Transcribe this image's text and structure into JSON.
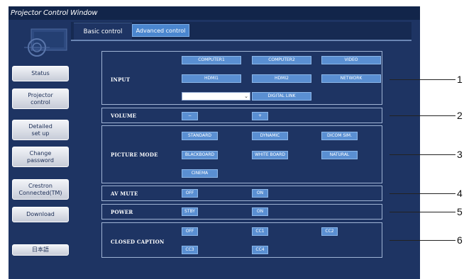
{
  "window": {
    "title": "Projector Control Window"
  },
  "sidebar": {
    "items": [
      {
        "label": "Status"
      },
      {
        "label": "Projector control"
      },
      {
        "label": "Detailed set up"
      },
      {
        "label": "Change password"
      },
      {
        "label": "Crestron Connected(TM)"
      },
      {
        "label": "Download"
      },
      {
        "label": "日本語"
      }
    ]
  },
  "tabs": {
    "basic": "Basic control",
    "advanced": "Advanced control"
  },
  "sections": {
    "input": {
      "label": "INPUT",
      "buttons": [
        "COMPUTER1",
        "COMPUTER2",
        "VIDEO",
        "HDMI1",
        "HDMI2",
        "NETWORK"
      ],
      "digital_link": "DIGITAL LINK",
      "select_value": ""
    },
    "volume": {
      "label": "VOLUME",
      "minus": "−",
      "plus": "+"
    },
    "picture_mode": {
      "label": "PICTURE MODE",
      "buttons": [
        "STANDARD",
        "DYNAMIC",
        "DICOM SIM.",
        "BLACKBOARD",
        "WHITE BOARD",
        "NATURAL",
        "CINEMA"
      ]
    },
    "av_mute": {
      "label": "AV MUTE",
      "off": "OFF",
      "on": "ON"
    },
    "power": {
      "label": "POWER",
      "standby": "STBY",
      "on": "ON"
    },
    "closed_caption": {
      "label": "CLOSED CAPTION",
      "buttons": [
        "OFF",
        "CC1",
        "CC2",
        "CC3",
        "CC4"
      ]
    }
  },
  "callouts": [
    "1",
    "2",
    "3",
    "4",
    "5",
    "6"
  ],
  "colors": {
    "window_bg": "#1e3463",
    "titlebar": "#12254a",
    "button": "#5a8fd2",
    "tab_active": "#4a86cf"
  }
}
